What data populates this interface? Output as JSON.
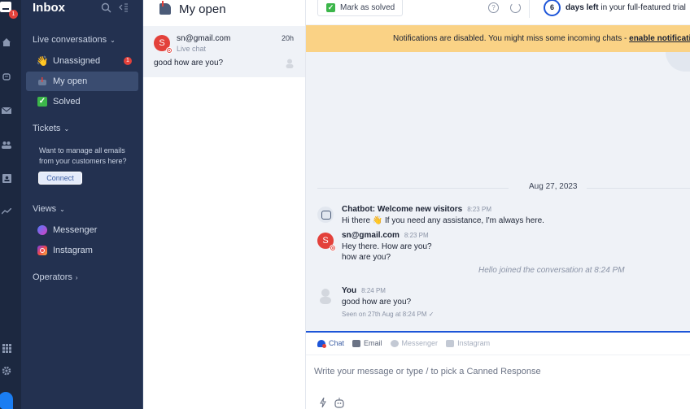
{
  "rail": {
    "logo_badge": "1",
    "icons": [
      "home-icon",
      "bot-icon",
      "mail-icon",
      "contacts-icon",
      "id-card-icon",
      "analytics-icon",
      "apps-grid-icon",
      "settings-icon"
    ]
  },
  "sidebar": {
    "title": "Inbox",
    "live_section": "Live conversations",
    "items": [
      {
        "label": "Unassigned",
        "emoji": "👋",
        "badge": "1"
      },
      {
        "label": "My open",
        "emoji": "📪"
      },
      {
        "label": "Solved",
        "emoji": "✓"
      }
    ],
    "tickets_section": "Tickets",
    "tickets_note": "Want to manage all emails from your customers here?",
    "connect_label": "Connect",
    "views_section": "Views",
    "views": [
      {
        "label": "Messenger"
      },
      {
        "label": "Instagram"
      }
    ],
    "operators_section": "Operators"
  },
  "conv_list": {
    "title": "My open",
    "conversations": [
      {
        "avatar": "S",
        "email": "sn@gmail.com",
        "time": "20h",
        "channel": "Live chat",
        "preview": "good how are you?"
      }
    ]
  },
  "topbar": {
    "mark_solved": "Mark as solved",
    "trial_days": "6",
    "trial_bold": "days left",
    "trial_rest": " in your full-featured trial"
  },
  "notification": {
    "text": "Notifications are disabled. You might miss some incoming chats - ",
    "link": "enable notifications"
  },
  "chat": {
    "date": "Aug 27, 2023",
    "messages": [
      {
        "name": "Chatbot: Welcome new visitors",
        "time": "8:23 PM",
        "lines": [
          "Hi there 👋 If you need any assistance, I'm always here."
        ]
      },
      {
        "avatar": "S",
        "name": "sn@gmail.com",
        "time": "8:23 PM",
        "lines": [
          "Hey there. How are you?",
          "how are you?"
        ]
      },
      {
        "name": "You",
        "time": "8:24 PM",
        "lines": [
          "good how are you?"
        ]
      }
    ],
    "system": "Hello joined the conversation at 8:24 PM",
    "seen": "Seen on 27th Aug at 8:24 PM ✓"
  },
  "composer": {
    "tabs": [
      {
        "label": "Chat",
        "active": true
      },
      {
        "label": "Email"
      },
      {
        "label": "Messenger"
      },
      {
        "label": "Instagram"
      }
    ],
    "placeholder": "Write your message or type / to pick a Canned Response"
  },
  "colors": {
    "accent": "#1d55d8",
    "sidebar_bg": "#233150",
    "banner": "#fad285",
    "badge": "#e3413b"
  }
}
